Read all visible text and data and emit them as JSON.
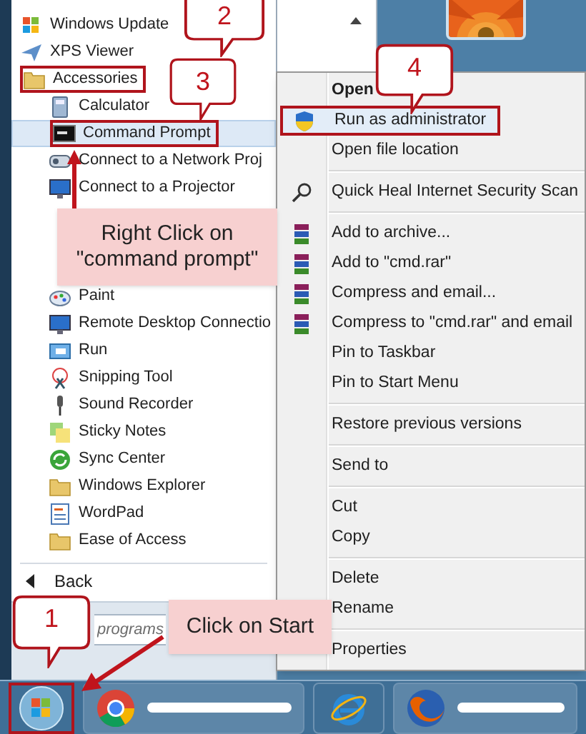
{
  "programs": [
    {
      "label": "Windows Update",
      "kind": "update",
      "boxed": false,
      "selected": false
    },
    {
      "label": "XPS Viewer",
      "kind": "xps",
      "boxed": false,
      "selected": false
    },
    {
      "label": "Accessories",
      "kind": "folder",
      "boxed": true,
      "selected": false,
      "children": [
        {
          "label": "Calculator",
          "kind": "calc",
          "boxed": false,
          "selected": false
        },
        {
          "label": "Command Prompt",
          "kind": "cmd",
          "boxed": true,
          "selected": true
        },
        {
          "label": "Connect to a Network Proj",
          "kind": "netproj",
          "boxed": false,
          "selected": false
        },
        {
          "label": "Connect to a Projector",
          "kind": "monitor",
          "boxed": false,
          "selected": false
        },
        {
          "label": "Paint",
          "kind": "paint",
          "boxed": false,
          "selected": false
        },
        {
          "label": "Remote Desktop Connectio",
          "kind": "monitor",
          "boxed": false,
          "selected": false
        },
        {
          "label": "Run",
          "kind": "run",
          "boxed": false,
          "selected": false
        },
        {
          "label": "Snipping Tool",
          "kind": "scissors",
          "boxed": false,
          "selected": false
        },
        {
          "label": "Sound Recorder",
          "kind": "mic",
          "boxed": false,
          "selected": false
        },
        {
          "label": "Sticky Notes",
          "kind": "notes",
          "boxed": false,
          "selected": false
        },
        {
          "label": "Sync Center",
          "kind": "sync",
          "boxed": false,
          "selected": false
        },
        {
          "label": "Windows Explorer",
          "kind": "folder",
          "boxed": false,
          "selected": false
        },
        {
          "label": "WordPad",
          "kind": "doc",
          "boxed": false,
          "selected": false
        },
        {
          "label": "Ease of Access",
          "kind": "folder",
          "boxed": false,
          "selected": false
        }
      ]
    }
  ],
  "back": {
    "label": "Back"
  },
  "search": {
    "placeholder": "programs"
  },
  "context_menu": [
    {
      "kind": "item",
      "label": "Open",
      "bold": true,
      "boxed": false
    },
    {
      "kind": "shield",
      "label": "Run as administrator",
      "bold": false,
      "boxed": true
    },
    {
      "kind": "item",
      "label": "Open file location",
      "bold": false,
      "boxed": false
    },
    {
      "kind": "separator"
    },
    {
      "kind": "search",
      "label": "Quick Heal Internet Security Scan",
      "bold": false,
      "boxed": false
    },
    {
      "kind": "separator"
    },
    {
      "kind": "books",
      "label": "Add to archive...",
      "bold": false,
      "boxed": false
    },
    {
      "kind": "books",
      "label": "Add to \"cmd.rar\"",
      "bold": false,
      "boxed": false
    },
    {
      "kind": "books",
      "label": "Compress and email...",
      "bold": false,
      "boxed": false
    },
    {
      "kind": "books",
      "label": "Compress to \"cmd.rar\" and email",
      "bold": false,
      "boxed": false
    },
    {
      "kind": "item",
      "label": "Pin to Taskbar",
      "bold": false,
      "boxed": false
    },
    {
      "kind": "item",
      "label": "Pin to Start Menu",
      "bold": false,
      "boxed": false
    },
    {
      "kind": "separator"
    },
    {
      "kind": "item",
      "label": "Restore previous versions",
      "bold": false,
      "boxed": false
    },
    {
      "kind": "separator"
    },
    {
      "kind": "item",
      "label": "Send to",
      "bold": false,
      "boxed": false
    },
    {
      "kind": "separator"
    },
    {
      "kind": "item",
      "label": "Cut",
      "bold": false,
      "boxed": false
    },
    {
      "kind": "item",
      "label": "Copy",
      "bold": false,
      "boxed": false
    },
    {
      "kind": "separator"
    },
    {
      "kind": "item",
      "label": "Delete",
      "bold": false,
      "boxed": false
    },
    {
      "kind": "item",
      "label": "Rename",
      "bold": false,
      "boxed": false
    },
    {
      "kind": "separator"
    },
    {
      "kind": "item",
      "label": "Properties",
      "bold": false,
      "boxed": false
    }
  ],
  "taskbar": [
    {
      "kind": "start",
      "boxed": true
    },
    {
      "kind": "chrome",
      "boxed": false
    },
    {
      "kind": "ie",
      "boxed": false
    },
    {
      "kind": "firefox",
      "boxed": false
    }
  ],
  "callouts": [
    {
      "text": "1"
    },
    {
      "text": "2"
    },
    {
      "text": "3"
    },
    {
      "text": "4"
    }
  ],
  "notes": [
    {
      "text": "Right Click on \"command prompt\""
    },
    {
      "text": "Click on Start"
    }
  ]
}
